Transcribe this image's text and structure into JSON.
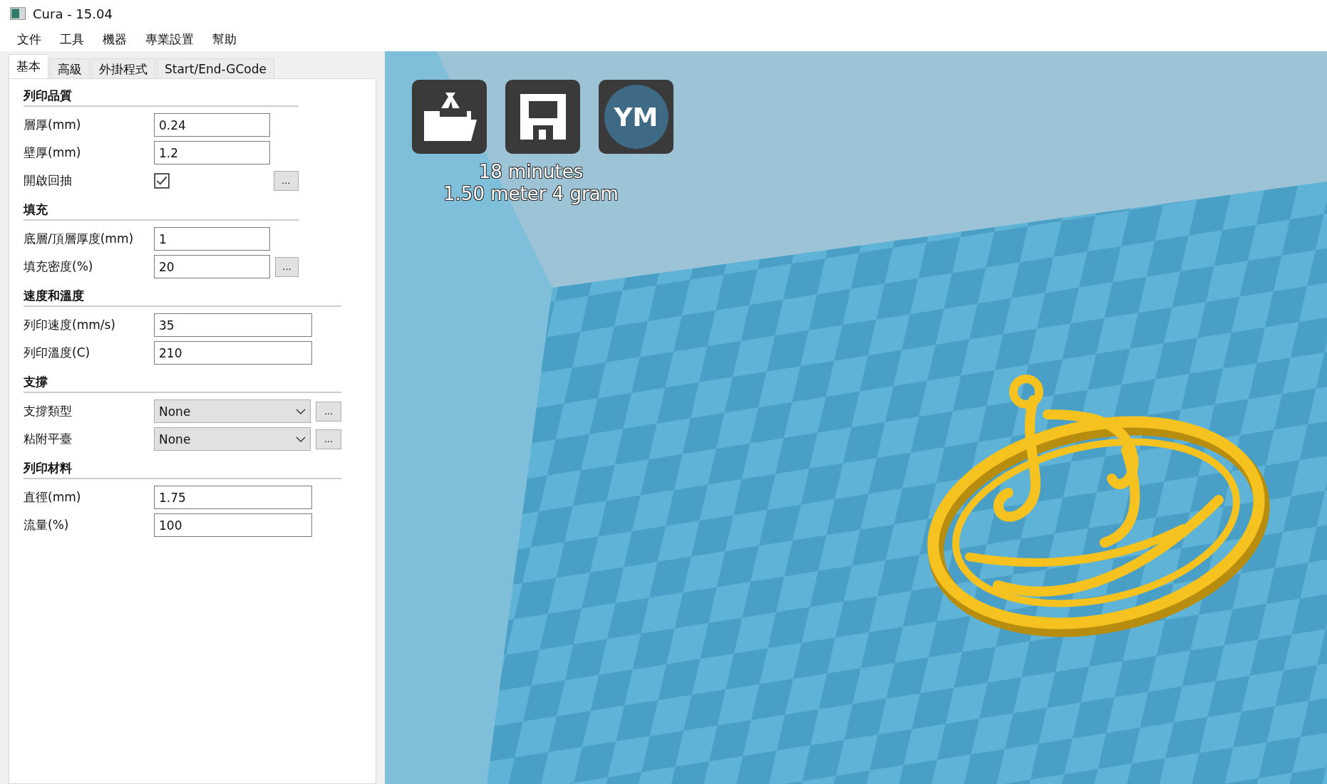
{
  "window": {
    "title": "Cura - 15.04"
  },
  "menu": [
    "文件",
    "工具",
    "機器",
    "專業設置",
    "幫助"
  ],
  "tabs": [
    {
      "label": "基本",
      "selected": true
    },
    {
      "label": "高級",
      "selected": false
    },
    {
      "label": "外掛程式",
      "selected": false
    },
    {
      "label": "Start/End-GCode",
      "selected": false
    }
  ],
  "sections": [
    {
      "title": "列印品質",
      "rows": [
        {
          "kind": "input",
          "label": "層厚(mm)",
          "value": "0.24"
        },
        {
          "kind": "input",
          "label": "壁厚(mm)",
          "value": "1.2"
        },
        {
          "kind": "checkbox",
          "label": "開啟回抽",
          "checked": true,
          "more_button": "..."
        }
      ]
    },
    {
      "title": "填充",
      "rows": [
        {
          "kind": "input",
          "label": "底層/頂層厚度(mm)",
          "value": "1"
        },
        {
          "kind": "input",
          "label": "填充密度(%)",
          "value": "20",
          "more_button": "..."
        }
      ]
    },
    {
      "title": "速度和溫度",
      "rows": [
        {
          "kind": "input",
          "label": "列印速度(mm/s)",
          "value": "35"
        },
        {
          "kind": "input",
          "label": "列印溫度(C)",
          "value": "210"
        }
      ]
    },
    {
      "title": "支撐",
      "rows": [
        {
          "kind": "select",
          "label": "支撐類型",
          "value": "None",
          "more_button": "..."
        },
        {
          "kind": "select",
          "label": "粘附平臺",
          "value": "None",
          "more_button": "..."
        }
      ]
    },
    {
      "title": "列印材料",
      "rows": [
        {
          "kind": "input",
          "label": "直徑(mm)",
          "value": "1.75"
        },
        {
          "kind": "input",
          "label": "流量(%)",
          "value": "100"
        }
      ]
    }
  ],
  "viewport": {
    "badge": "YM",
    "estimate": [
      "18 minutes",
      "1.50 meter 4 gram"
    ]
  }
}
